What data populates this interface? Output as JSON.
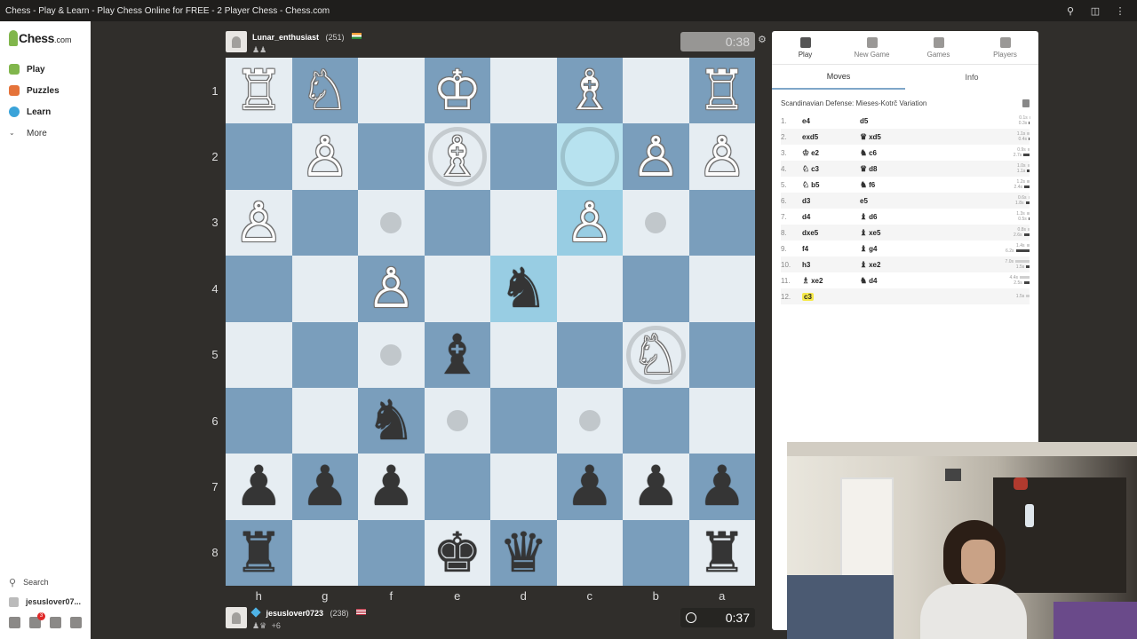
{
  "browser": {
    "tab_title": "Chess - Play & Learn - Play Chess Online for FREE - 2 Player Chess - Chess.com",
    "icons": [
      "search-icon",
      "extension-icon",
      "more-icon"
    ]
  },
  "sidebar": {
    "logo": "Chess",
    "logo_domain": ".com",
    "items": [
      {
        "label": "Play",
        "icon": "play-icon",
        "color": "#81b64c"
      },
      {
        "label": "Puzzles",
        "icon": "puzzle-icon",
        "color": "#e5733a"
      },
      {
        "label": "Learn",
        "icon": "learn-icon",
        "color": "#3aa3d9"
      },
      {
        "label": "More",
        "icon": "chevron-down-icon"
      }
    ],
    "search_label": "Search",
    "user_label": "jesuslover07...",
    "notif_badge": "3"
  },
  "opponent": {
    "name": "Lunar_enthusiast",
    "rating": "(251)",
    "clock": "0:38",
    "captured": "♟♟"
  },
  "player": {
    "name": "jesuslover0723",
    "rating": "(238)",
    "clock": "0:37",
    "captured": "♟♛",
    "advantage": "+6"
  },
  "board": {
    "rank_labels": [
      "1",
      "2",
      "3",
      "4",
      "5",
      "6",
      "7",
      "8"
    ],
    "file_labels": [
      "h",
      "g",
      "f",
      "e",
      "d",
      "c",
      "b",
      "a"
    ],
    "colors": {
      "light": "#e6edf2",
      "dark": "#7a9ebc",
      "highlight": "#98cde3"
    },
    "squares": [
      [
        "wR",
        "wN",
        "",
        "wK",
        "",
        "wB",
        "",
        "wR"
      ],
      [
        "",
        "wP",
        "",
        "wB*",
        "",
        "hl-ring",
        "wP",
        "wP"
      ],
      [
        "wP",
        "",
        "dot",
        "",
        "",
        "hl:wP",
        "dot",
        ""
      ],
      [
        "",
        "",
        "wP",
        "",
        "hl:bN",
        "",
        "",
        ""
      ],
      [
        "",
        "",
        "dot",
        "bB",
        "",
        "",
        "wN*",
        ""
      ],
      [
        "",
        "",
        "bN",
        "dot",
        "",
        "dot",
        "",
        ""
      ],
      [
        "bP",
        "bP",
        "bP",
        "",
        "",
        "bP",
        "bP",
        "bP"
      ],
      [
        "bR",
        "",
        "",
        "bK",
        "bQ",
        "",
        "",
        "bR"
      ]
    ]
  },
  "panel": {
    "tabs": [
      {
        "label": "Play",
        "icon": "play-icon",
        "active": true
      },
      {
        "label": "New Game",
        "icon": "plus-icon"
      },
      {
        "label": "Games",
        "icon": "games-icon"
      },
      {
        "label": "Players",
        "icon": "players-icon"
      }
    ],
    "subtabs": [
      "Moves",
      "Info"
    ],
    "opening": "Scandinavian Defense: Mieses-Kotrč Variation",
    "moves": [
      {
        "n": "1.",
        "w": "e4",
        "wf": "",
        "b": "d5",
        "bf": "",
        "t": [
          "0.1s",
          "0.3s"
        ]
      },
      {
        "n": "2.",
        "w": "exd5",
        "wf": "",
        "b": "xd5",
        "bf": "♛",
        "t": [
          "1.1s",
          "0.4s"
        ]
      },
      {
        "n": "3.",
        "w": "e2",
        "wf": "♔",
        "b": "c6",
        "bf": "♞",
        "t": [
          "0.9s",
          "2.7s"
        ]
      },
      {
        "n": "4.",
        "w": "c3",
        "wf": "♘",
        "b": "d8",
        "bf": "♛",
        "t": [
          "1.0s",
          "1.1s"
        ]
      },
      {
        "n": "5.",
        "w": "b5",
        "wf": "♘",
        "b": "f6",
        "bf": "♞",
        "t": [
          "1.2s",
          "2.4s"
        ]
      },
      {
        "n": "6.",
        "w": "d3",
        "wf": "",
        "b": "e5",
        "bf": "",
        "t": [
          "0.6s",
          "1.8s"
        ]
      },
      {
        "n": "7.",
        "w": "d4",
        "wf": "",
        "b": "d6",
        "bf": "♝",
        "t": [
          "1.3s",
          "0.5s"
        ]
      },
      {
        "n": "8.",
        "w": "dxe5",
        "wf": "",
        "b": "xe5",
        "bf": "♝",
        "t": [
          "0.8s",
          "2.6s"
        ]
      },
      {
        "n": "9.",
        "w": "f4",
        "wf": "",
        "b": "g4",
        "bf": "♝",
        "t": [
          "1.4s",
          "6.2s"
        ]
      },
      {
        "n": "10.",
        "w": "h3",
        "wf": "",
        "b": "xe2",
        "bf": "♝",
        "t": [
          "7.0s",
          "1.5s"
        ]
      },
      {
        "n": "11.",
        "w": "xe2",
        "wf": "♗",
        "b": "d4",
        "bf": "♞",
        "t": [
          "4.4s",
          "2.5s"
        ]
      },
      {
        "n": "12.",
        "w": "c3",
        "wf": "",
        "b": "",
        "bf": "",
        "t": [
          "1.5s"
        ],
        "current": true
      }
    ]
  }
}
